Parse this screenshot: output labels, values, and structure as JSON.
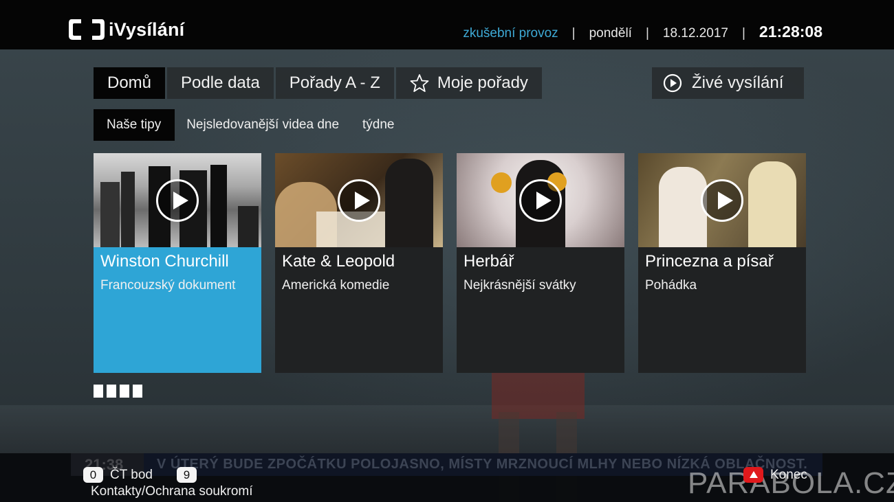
{
  "app": {
    "logo_text": "iVysílání",
    "mode": "zkušební provoz",
    "day": "pondělí",
    "date": "18.12.2017",
    "time": "21:28:08",
    "separator": "|"
  },
  "main_tabs": [
    {
      "label": "Domů",
      "active": true
    },
    {
      "label": "Podle data",
      "active": false
    },
    {
      "label": "Pořady A - Z",
      "active": false
    },
    {
      "label": "Moje pořady",
      "active": false,
      "icon": "star-icon"
    }
  ],
  "live_tab": {
    "label": "Živé vysílání",
    "icon": "play-circle-icon"
  },
  "sub_tabs": [
    {
      "label": "Naše tipy",
      "active": true
    },
    {
      "label": "Nejsledovanější videa dne",
      "active": false
    },
    {
      "label": "týdne",
      "active": false
    }
  ],
  "cards": [
    {
      "title": "Winston Churchill",
      "subtitle": "Francouzský dokument",
      "selected": true
    },
    {
      "title": "Kate & Leopold",
      "subtitle": "Americká komedie",
      "selected": false
    },
    {
      "title": "Herbář",
      "subtitle": "Nejkrásnější svátky",
      "selected": false
    },
    {
      "title": "Princezna a písař",
      "subtitle": "Pohádka",
      "selected": false
    }
  ],
  "pager_count": 4,
  "ticker": {
    "clock": "21:38",
    "text": "V ÚTERÝ BUDE ZPOČÁTKU POLOJASNO, MÍSTY MRZNOUCÍ MLHY NEBO NÍZKÁ OBLAČNOST."
  },
  "footer": {
    "key0": "0",
    "key0_label": "ČT bod",
    "key9": "9",
    "link": "Kontakty/Ochrana soukromí",
    "exit_label": "Konec"
  },
  "watermark": "PARABOLA.CZ",
  "colors": {
    "accent": "#2ea5d6",
    "mode_text": "#3eaad6",
    "red_key": "#e0191c"
  }
}
